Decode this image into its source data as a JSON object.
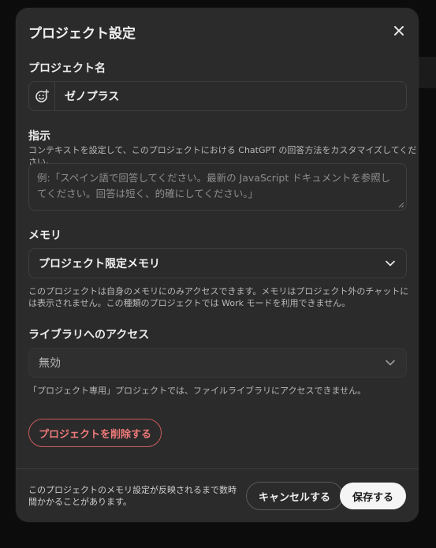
{
  "dialog": {
    "title": "プロジェクト設定",
    "close_icon": "close-icon"
  },
  "project_name": {
    "label": "プロジェクト名",
    "icon": "emoji-icon",
    "value": "ゼノプラス"
  },
  "instructions": {
    "label": "指示",
    "hint": "コンテキストを設定して、このプロジェクトにおける ChatGPT の回答方法をカスタマイズしてください。",
    "placeholder": "例:「スペイン語で回答してください。最新の JavaScript ドキュメントを参照してください。回答は短く、的確にしてください。」"
  },
  "memory": {
    "label": "メモリ",
    "selected": "プロジェクト限定メモリ",
    "hint": "このプロジェクトは自身のメモリにのみアクセスできます。メモリはプロジェクト外のチャットには表示されません。この種類のプロジェクトでは Work モードを利用できません。"
  },
  "library_access": {
    "label": "ライブラリへのアクセス",
    "selected": "無効",
    "hint": "「プロジェクト専用」プロジェクトでは、ファイルライブラリにアクセスできません。"
  },
  "delete_button": "プロジェクトを削除する",
  "footer": {
    "note": "このプロジェクトのメモリ設定が反映されるまで数時間かかることがあります。",
    "cancel_label": "キャンセルする",
    "save_label": "保存する"
  },
  "colors": {
    "modal_bg": "#2b2b2b",
    "danger": "#f07a7a",
    "primary_button_bg": "#f5f5f5"
  }
}
